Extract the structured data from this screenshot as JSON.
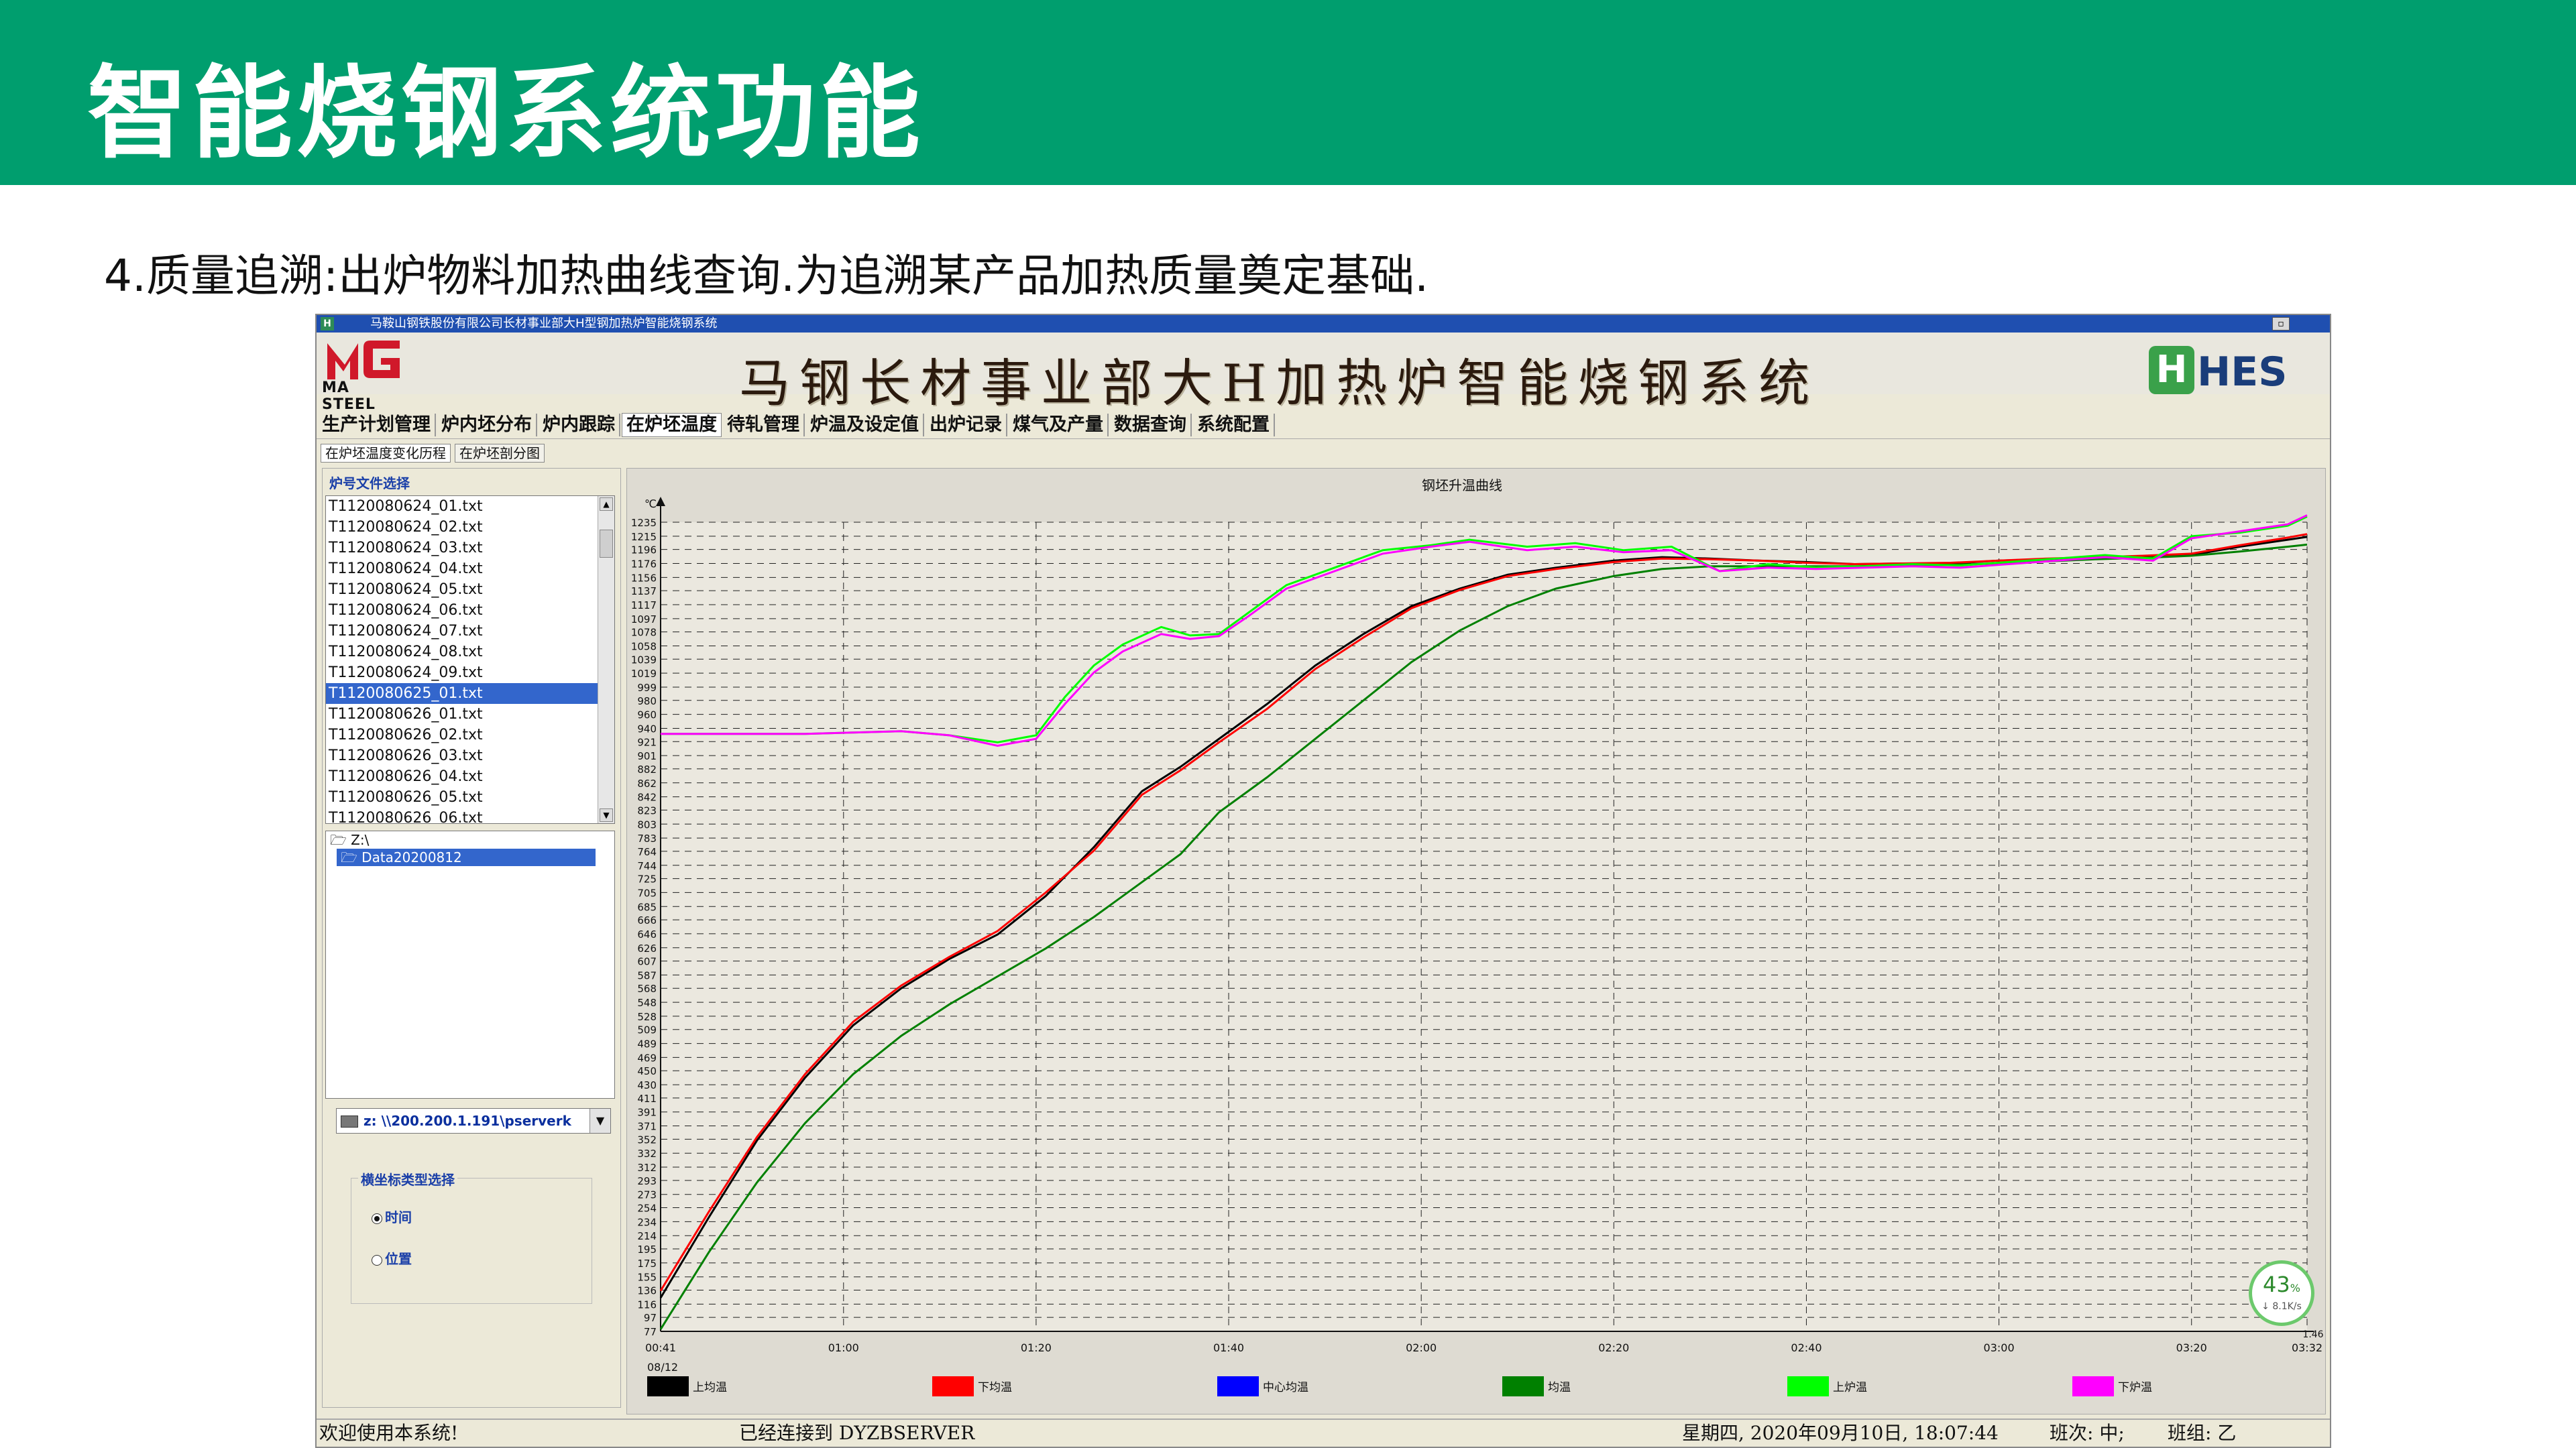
{
  "banner": {
    "title": "智能烧钢系统功能"
  },
  "subtitle": "4.质量追溯:出炉物料加热曲线查询.为追溯某产品加热质量奠定基础.",
  "app": {
    "window_title": "马鞍山钢铁股份有限公司长材事业部大H型钢加热炉智能烧钢系统",
    "logo_left_text": "MA STEEL",
    "system_title": "马钢长材事业部大H加热炉智能烧钢系统",
    "logo_right_text": "HES",
    "menu": [
      "生产计划管理",
      "炉内坯分布",
      "炉内跟踪",
      "在炉坯温度",
      "待轧管理",
      "炉温及设定值",
      "出炉记录",
      "煤气及产量",
      "数据查询",
      "系统配置"
    ],
    "menu_active_index": 3,
    "subtabs": [
      "在炉坯温度变化历程",
      "在炉坯剖分图"
    ],
    "left": {
      "file_select_label": "炉号文件选择",
      "files": [
        "T1120080624_01.txt",
        "T1120080624_02.txt",
        "T1120080624_03.txt",
        "T1120080624_04.txt",
        "T1120080624_05.txt",
        "T1120080624_06.txt",
        "T1120080624_07.txt",
        "T1120080624_08.txt",
        "T1120080624_09.txt",
        "T1120080625_01.txt",
        "T1120080626_01.txt",
        "T1120080626_02.txt",
        "T1120080626_03.txt",
        "T1120080626_04.txt",
        "T1120080626_05.txt",
        "T1120080626_06.txt"
      ],
      "selected_file_index": 9,
      "folders": [
        "Z:\\",
        "Data20200812"
      ],
      "drive": "z: \\\\200.200.1.191\\pserverk",
      "axis_group_title": "横坐标类型选择",
      "radio_time": "时间",
      "radio_position": "位置",
      "radio_selected": "时间"
    },
    "status": {
      "welcome": "欢迎使用本系统!",
      "connected": "已经连接到 DYZBSERVER",
      "datetime": "星期四, 2020年09月10日, 18:07:44",
      "shift": "班次: 中;",
      "team": "班组: 乙"
    },
    "net_widget": {
      "percent": "43",
      "percent_unit": "%",
      "speed": "↓ 8.1K/s"
    }
  },
  "chart_data": {
    "type": "line",
    "title": "钢坯升温曲线",
    "ylabel": "℃",
    "y_ticks": [
      77,
      97,
      116,
      136,
      155,
      175,
      195,
      214,
      234,
      254,
      273,
      293,
      312,
      332,
      352,
      371,
      391,
      411,
      430,
      450,
      469,
      489,
      509,
      528,
      548,
      568,
      587,
      607,
      626,
      646,
      666,
      685,
      705,
      725,
      744,
      764,
      783,
      803,
      823,
      842,
      862,
      882,
      901,
      921,
      940,
      960,
      980,
      999,
      1019,
      1039,
      1058,
      1078,
      1097,
      1117,
      1137,
      1156,
      1176,
      1196,
      1215,
      1235
    ],
    "ylim": [
      77,
      1235
    ],
    "x_ticks": [
      "00:41",
      "01:00",
      "01:20",
      "01:40",
      "02:00",
      "02:20",
      "02:40",
      "03:00",
      "03:20",
      "03:32"
    ],
    "x_tick_minutes": [
      41,
      60,
      80,
      100,
      120,
      140,
      160,
      180,
      200,
      212
    ],
    "x_date_label": "08/12",
    "xlim": [
      41,
      212
    ],
    "corner_label": "1.46",
    "legend": [
      "上均温",
      "下均温",
      "中心均温",
      "均温",
      "上炉温",
      "下炉温"
    ],
    "legend_colors": [
      "#000000",
      "#ff0000",
      "#0000ff",
      "#008000",
      "#00ff00",
      "#ff00ff"
    ],
    "series": [
      {
        "name": "上均温",
        "color": "#000000",
        "points": [
          [
            41,
            125
          ],
          [
            46,
            240
          ],
          [
            51,
            350
          ],
          [
            56,
            440
          ],
          [
            61,
            515
          ],
          [
            66,
            568
          ],
          [
            71,
            610
          ],
          [
            76,
            645
          ],
          [
            81,
            700
          ],
          [
            86,
            770
          ],
          [
            91,
            850
          ],
          [
            95,
            885
          ],
          [
            99,
            925
          ],
          [
            104,
            975
          ],
          [
            109,
            1030
          ],
          [
            114,
            1075
          ],
          [
            119,
            1115
          ],
          [
            124,
            1140
          ],
          [
            129,
            1160
          ],
          [
            134,
            1170
          ],
          [
            140,
            1180
          ],
          [
            145,
            1185
          ],
          [
            150,
            1183
          ],
          [
            155,
            1180
          ],
          [
            160,
            1178
          ],
          [
            165,
            1175
          ],
          [
            170,
            1176
          ],
          [
            175,
            1176
          ],
          [
            180,
            1180
          ],
          [
            185,
            1182
          ],
          [
            190,
            1184
          ],
          [
            195,
            1186
          ],
          [
            200,
            1188
          ],
          [
            205,
            1200
          ],
          [
            210,
            1210
          ],
          [
            212,
            1214
          ]
        ]
      },
      {
        "name": "下均温",
        "color": "#ff0000",
        "points": [
          [
            41,
            135
          ],
          [
            46,
            248
          ],
          [
            51,
            355
          ],
          [
            56,
            445
          ],
          [
            61,
            520
          ],
          [
            66,
            572
          ],
          [
            71,
            613
          ],
          [
            76,
            650
          ],
          [
            81,
            705
          ],
          [
            86,
            765
          ],
          [
            91,
            845
          ],
          [
            95,
            880
          ],
          [
            99,
            920
          ],
          [
            104,
            968
          ],
          [
            109,
            1025
          ],
          [
            114,
            1070
          ],
          [
            119,
            1112
          ],
          [
            124,
            1138
          ],
          [
            129,
            1158
          ],
          [
            134,
            1168
          ],
          [
            140,
            1178
          ],
          [
            145,
            1183
          ],
          [
            150,
            1182
          ],
          [
            155,
            1180
          ],
          [
            160,
            1177
          ],
          [
            165,
            1175
          ],
          [
            170,
            1176
          ],
          [
            175,
            1177
          ],
          [
            180,
            1180
          ],
          [
            185,
            1183
          ],
          [
            190,
            1185
          ],
          [
            195,
            1187
          ],
          [
            200,
            1190
          ],
          [
            205,
            1202
          ],
          [
            210,
            1213
          ],
          [
            212,
            1218
          ]
        ]
      },
      {
        "name": "均温",
        "color": "#008000",
        "points": [
          [
            41,
            80
          ],
          [
            46,
            190
          ],
          [
            51,
            290
          ],
          [
            56,
            375
          ],
          [
            61,
            445
          ],
          [
            66,
            500
          ],
          [
            71,
            545
          ],
          [
            76,
            585
          ],
          [
            81,
            625
          ],
          [
            86,
            670
          ],
          [
            91,
            720
          ],
          [
            95,
            760
          ],
          [
            99,
            820
          ],
          [
            104,
            870
          ],
          [
            109,
            925
          ],
          [
            114,
            980
          ],
          [
            119,
            1035
          ],
          [
            124,
            1080
          ],
          [
            129,
            1115
          ],
          [
            134,
            1140
          ],
          [
            140,
            1158
          ],
          [
            145,
            1168
          ],
          [
            150,
            1172
          ],
          [
            155,
            1172
          ],
          [
            160,
            1172
          ],
          [
            165,
            1172
          ],
          [
            170,
            1173
          ],
          [
            175,
            1174
          ],
          [
            180,
            1176
          ],
          [
            185,
            1179
          ],
          [
            190,
            1182
          ],
          [
            195,
            1184
          ],
          [
            200,
            1187
          ],
          [
            205,
            1193
          ],
          [
            210,
            1200
          ],
          [
            212,
            1203
          ]
        ]
      },
      {
        "name": "上炉温",
        "color": "#00ff00",
        "points": [
          [
            41,
            932
          ],
          [
            56,
            932
          ],
          [
            61,
            934
          ],
          [
            66,
            936
          ],
          [
            71,
            930
          ],
          [
            76,
            920
          ],
          [
            80,
            930
          ],
          [
            83,
            985
          ],
          [
            86,
            1030
          ],
          [
            89,
            1060
          ],
          [
            93,
            1085
          ],
          [
            96,
            1073
          ],
          [
            99,
            1075
          ],
          [
            102,
            1105
          ],
          [
            106,
            1145
          ],
          [
            111,
            1170
          ],
          [
            116,
            1195
          ],
          [
            121,
            1202
          ],
          [
            125,
            1210
          ],
          [
            131,
            1200
          ],
          [
            136,
            1205
          ],
          [
            141,
            1195
          ],
          [
            146,
            1200
          ],
          [
            151,
            1165
          ],
          [
            156,
            1175
          ],
          [
            161,
            1170
          ],
          [
            166,
            1172
          ],
          [
            171,
            1175
          ],
          [
            176,
            1173
          ],
          [
            181,
            1178
          ],
          [
            186,
            1183
          ],
          [
            191,
            1188
          ],
          [
            196,
            1183
          ],
          [
            200,
            1215
          ],
          [
            205,
            1220
          ],
          [
            210,
            1230
          ],
          [
            212,
            1243
          ]
        ]
      },
      {
        "name": "下炉温",
        "color": "#ff00ff",
        "points": [
          [
            41,
            932
          ],
          [
            56,
            932
          ],
          [
            61,
            934
          ],
          [
            66,
            936
          ],
          [
            71,
            930
          ],
          [
            76,
            915
          ],
          [
            80,
            925
          ],
          [
            83,
            975
          ],
          [
            86,
            1020
          ],
          [
            89,
            1050
          ],
          [
            93,
            1075
          ],
          [
            96,
            1068
          ],
          [
            99,
            1072
          ],
          [
            102,
            1100
          ],
          [
            106,
            1140
          ],
          [
            111,
            1165
          ],
          [
            116,
            1190
          ],
          [
            121,
            1200
          ],
          [
            125,
            1207
          ],
          [
            131,
            1195
          ],
          [
            136,
            1200
          ],
          [
            141,
            1192
          ],
          [
            146,
            1195
          ],
          [
            151,
            1165
          ],
          [
            156,
            1170
          ],
          [
            161,
            1168
          ],
          [
            166,
            1170
          ],
          [
            171,
            1172
          ],
          [
            176,
            1170
          ],
          [
            181,
            1175
          ],
          [
            186,
            1180
          ],
          [
            191,
            1185
          ],
          [
            196,
            1180
          ],
          [
            200,
            1212
          ],
          [
            205,
            1222
          ],
          [
            210,
            1232
          ],
          [
            212,
            1245
          ]
        ]
      }
    ],
    "grid": true
  }
}
